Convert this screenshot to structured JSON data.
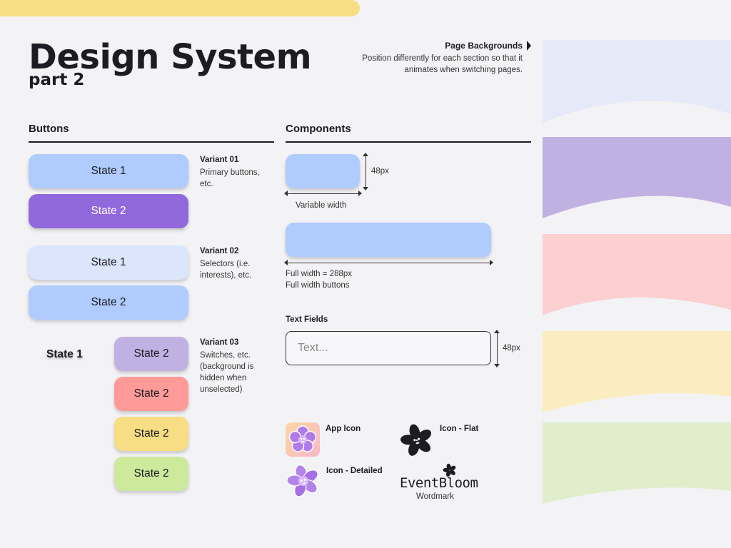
{
  "header": {
    "title": "Design System",
    "subtitle": "part 2"
  },
  "page_backgrounds": {
    "title": "Page Backgrounds",
    "description": "Position differently for each section so that it animates when switching pages.",
    "colors": [
      "#e5e9f8",
      "#c1b1e2",
      "#fccfd0",
      "#fbedc0",
      "#e1eecc"
    ]
  },
  "buttons_section": {
    "heading": "Buttons",
    "variant01": {
      "title": "Variant 01",
      "description": "Primary buttons, etc.",
      "state1": "State 1",
      "state2": "State 2"
    },
    "variant02": {
      "title": "Variant 02",
      "description": "Selectors (i.e. interests), etc.",
      "state1": "State 1",
      "state2": "State 2"
    },
    "variant03": {
      "title": "Variant 03",
      "description": "Switches, etc. (background is hidden when unselected)",
      "state1": "State 1",
      "state2_purple": "State 2",
      "state2_red": "State 2",
      "state2_yellow": "State 2",
      "state2_green": "State 2"
    }
  },
  "components_section": {
    "heading": "Components",
    "height_label": "48px",
    "variable_width_label": "Variable width",
    "full_width_label": "Full width = 288px",
    "full_width_buttons_label": "Full width buttons",
    "text_fields_label": "Text Fields",
    "text_field_placeholder": "Text...",
    "text_field_height_label": "48px",
    "app_icon_label": "App Icon",
    "icon_flat_label": "Icon - Flat",
    "icon_detailed_label": "Icon - Detailed",
    "wordmark_text": "EventBloom",
    "wordmark_label": "Wordmark"
  },
  "colors": {
    "light_blue": "#b0cbfe",
    "pale_blue": "#dbe6fd",
    "purple": "#9169dc",
    "lavender": "#c1b1e2",
    "red": "#fe9a97",
    "yellow": "#f7dd84",
    "green": "#cce99c",
    "accent_bar": "#f7dd84"
  }
}
